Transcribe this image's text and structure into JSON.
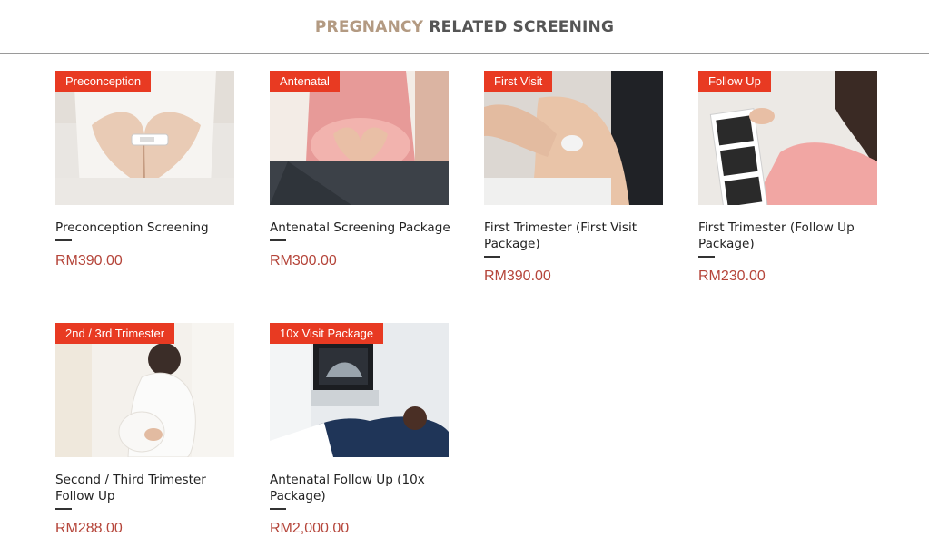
{
  "section": {
    "title_accent": "PREGNANCY",
    "title_rest": "RELATED SCREENING"
  },
  "products": [
    {
      "tag": "Preconception",
      "name": "Preconception Screening",
      "price": "RM390.00",
      "image_subject": "hands forming heart shape over belly with pregnancy test"
    },
    {
      "tag": "Antenatal",
      "name": "Antenatal Screening Package",
      "price": "RM300.00",
      "image_subject": "pregnant woman in pink top forming heart with hands on belly"
    },
    {
      "tag": "First Visit",
      "name": "First Trimester (First Visit Package)",
      "price": "RM390.00",
      "image_subject": "ultrasound probe on abdomen"
    },
    {
      "tag": "Follow Up",
      "name": "First Trimester (Follow Up Package)",
      "price": "RM230.00",
      "image_subject": "woman holding ultrasound scan prints"
    },
    {
      "tag": "2nd / 3rd Trimester",
      "name": "Second / Third Trimester Follow Up",
      "price": "RM288.00",
      "image_subject": "pregnant woman in white dress by window"
    },
    {
      "tag": "10x Visit Package",
      "name": "Antenatal Follow Up (10x Package)",
      "price": "RM2,000.00",
      "image_subject": "ultrasound scan in clinic with monitor"
    }
  ],
  "colors": {
    "accent": "#b39a82",
    "heading": "#555555",
    "tag_bg": "#e83a22",
    "price": "#b5453a"
  }
}
